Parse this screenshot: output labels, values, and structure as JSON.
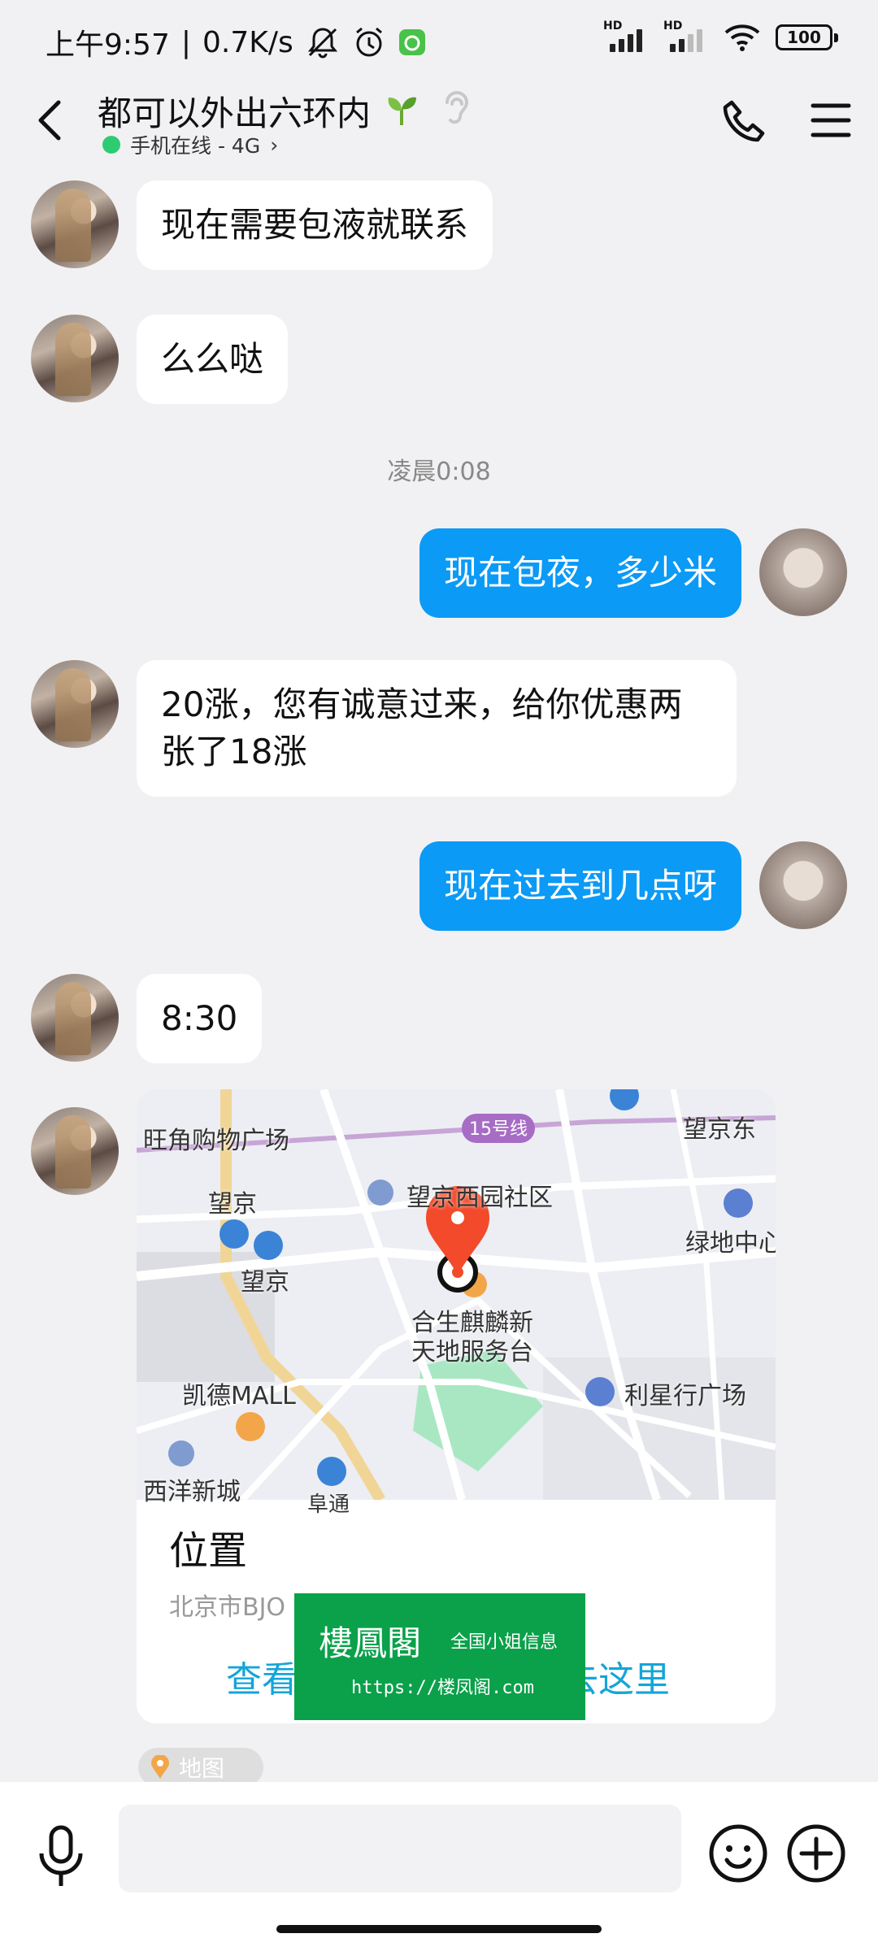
{
  "status_bar": {
    "time": "上午9:57",
    "speed": "0.7K/s",
    "sim1_label": "HD",
    "sim2_label": "HD",
    "battery": "100"
  },
  "header": {
    "title": "都可以外出六环内",
    "online_status": "手机在线 - 4G",
    "online_chevron": "›"
  },
  "messages": [
    {
      "from": "them",
      "text": "现在需要包液就联系"
    },
    {
      "from": "them",
      "text": "么么哒"
    },
    {
      "from": "system",
      "text": "凌晨0:08"
    },
    {
      "from": "me",
      "text": "现在包夜，多少米"
    },
    {
      "from": "them",
      "text_line1": "20涨，您有诚意过来，给你优惠两",
      "text_line2": "张了18涨"
    },
    {
      "from": "me",
      "text": "现在过去到几点呀"
    },
    {
      "from": "them",
      "text": "8:30"
    }
  ],
  "location_card": {
    "map_labels": {
      "mall1": "旺角购物广场",
      "line15": "15号线",
      "wangjing_east": "望京东",
      "wangjing_west_community": "望京西园社区",
      "wangjing1": "望京",
      "wangjing2": "望京",
      "lvdi": "绿地中心",
      "hesheng": "合生麒麟新",
      "hesheng2": "天地服务台",
      "kaide": "凯德MALL",
      "lixing": "利星行广场",
      "xiyang": "西洋新城",
      "huangqu": "阜通"
    },
    "title": "位置",
    "address": "北京市BJO 200 SPACE",
    "action_left": "查看",
    "action_right": "去这里"
  },
  "watermark": {
    "brand": "樓鳳閣",
    "tagline": "全国小姐信息",
    "url": "https://楼凤阁.com"
  },
  "map_chip": {
    "label": "地图"
  },
  "input_bar": {
    "placeholder": ""
  },
  "colors": {
    "accent": "#0b9af6",
    "background": "#f1f1f3",
    "online_dot": "#2ecc71",
    "pin": "#f24a2a",
    "watermark_bg": "#0aa14a"
  }
}
